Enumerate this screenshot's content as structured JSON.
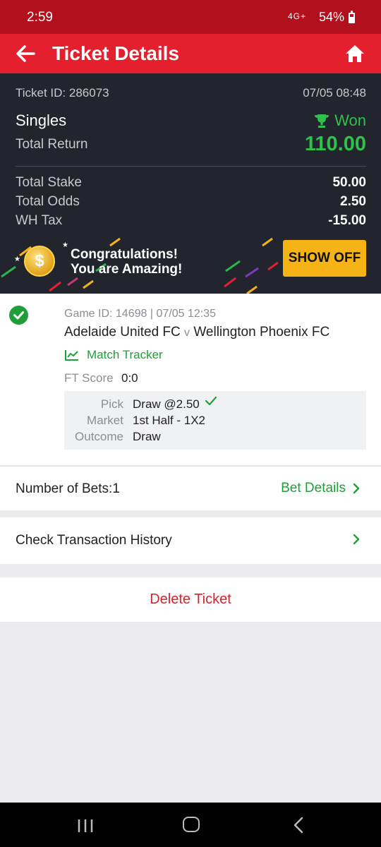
{
  "status_bar": {
    "time": "2:59",
    "network": "4G+",
    "battery": "54%"
  },
  "app_bar": {
    "title": "Ticket Details",
    "back_icon": "arrow-left-icon",
    "home_icon": "home-icon"
  },
  "ticket": {
    "id": "Ticket ID: 286073",
    "date": "07/05 08:48",
    "bet_type": "Singles",
    "status": "Won",
    "total_return_label": "Total Return",
    "total_return": "110.00",
    "rows": [
      {
        "label": "Total Stake",
        "value": "50.00"
      },
      {
        "label": "Total Odds",
        "value": "2.50"
      },
      {
        "label": "WH Tax",
        "value": "-15.00"
      }
    ]
  },
  "banner": {
    "line1": "Congratulations!",
    "line2": "You are Amazing!",
    "button": "SHOW OFF",
    "coin_symbol": "$"
  },
  "selection": {
    "game": "Game ID: 14698 | 07/05 12:35",
    "home_team": "Adelaide United FC",
    "vs": "v",
    "away_team": "Wellington Phoenix FC",
    "tracker": "Match Tracker",
    "ft_label": "FT Score",
    "ft_value": "0:0",
    "pick_label": "Pick",
    "pick_value": "Draw @2.50",
    "market_label": "Market",
    "market_value": "1st Half - 1X2",
    "outcome_label": "Outcome",
    "outcome_value": "Draw"
  },
  "bets": {
    "label": "Number of Bets:1",
    "link": "Bet Details"
  },
  "transaction": {
    "label": "Check Transaction History"
  },
  "delete": {
    "label": "Delete Ticket"
  },
  "colors": {
    "brand_red": "#e4202f",
    "status_red": "#b3101d",
    "win_green": "#2ec24a",
    "link_green": "#1f9e3a",
    "cta_yellow": "#f6b315",
    "dark_bg": "#22252d"
  }
}
